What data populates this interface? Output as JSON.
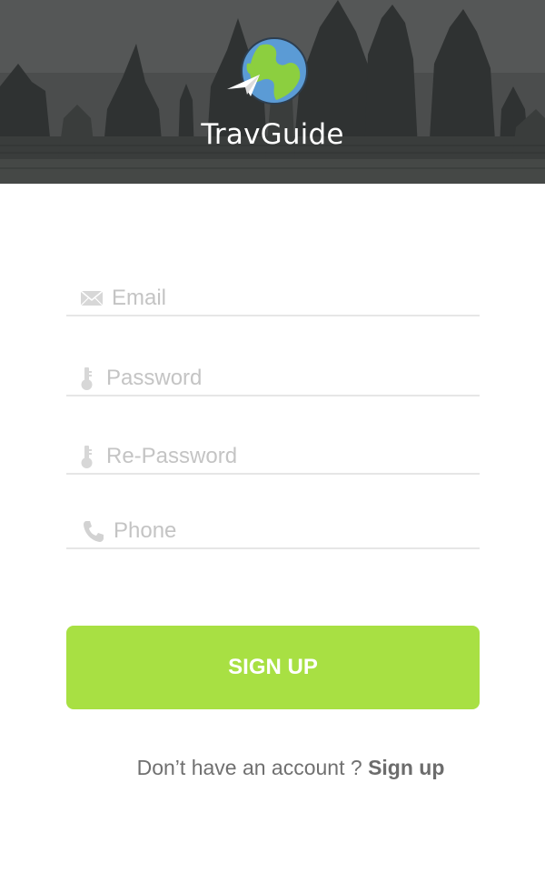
{
  "header": {
    "app_title": "TravGuide",
    "logo_icon": "globe-paper-plane-icon"
  },
  "form": {
    "email": {
      "placeholder": "Email",
      "value": "",
      "icon": "envelope-icon"
    },
    "password": {
      "placeholder": "Password",
      "value": "",
      "icon": "key-icon"
    },
    "repassword": {
      "placeholder": "Re-Password",
      "value": "",
      "icon": "key-icon"
    },
    "phone": {
      "placeholder": "Phone",
      "value": "",
      "icon": "phone-icon"
    },
    "submit_label": "SIGN UP"
  },
  "footer": {
    "prompt": "Don’t have an account ?",
    "link": "Sign up"
  },
  "colors": {
    "accent": "#a8e043",
    "input_line": "#e6e6e6",
    "placeholder": "#c4c4c4",
    "footer_text": "#707070"
  }
}
